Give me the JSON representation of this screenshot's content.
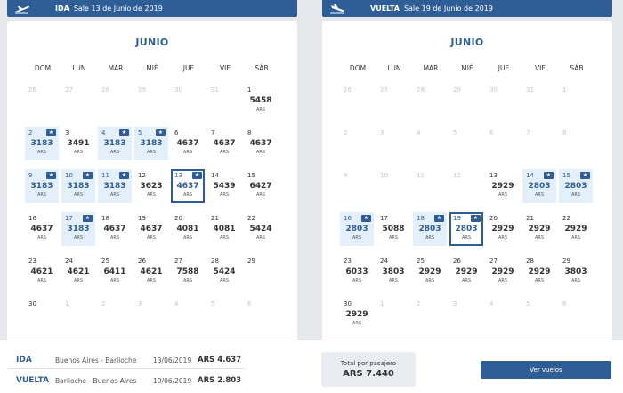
{
  "ida": {
    "label": "IDA",
    "subtitle": "Sale 13 de Junio de 2019",
    "month": "JUNIO",
    "currency": "ARS",
    "days": [
      {
        "n": "26",
        "out": true
      },
      {
        "n": "27",
        "out": true
      },
      {
        "n": "28",
        "out": true
      },
      {
        "n": "29",
        "out": true
      },
      {
        "n": "30",
        "out": true
      },
      {
        "n": "31",
        "out": true
      },
      {
        "n": "1",
        "price": "5458"
      },
      {
        "n": "2",
        "price": "3183",
        "promo": true
      },
      {
        "n": "3",
        "price": "3491"
      },
      {
        "n": "4",
        "price": "3183",
        "promo": true
      },
      {
        "n": "5",
        "price": "3183",
        "promo": true
      },
      {
        "n": "6",
        "price": "4637"
      },
      {
        "n": "7",
        "price": "4637"
      },
      {
        "n": "8",
        "price": "4637"
      },
      {
        "n": "9",
        "price": "3183",
        "promo": true
      },
      {
        "n": "10",
        "price": "3183",
        "promo": true
      },
      {
        "n": "11",
        "price": "3183",
        "promo": true
      },
      {
        "n": "12",
        "price": "3623"
      },
      {
        "n": "13",
        "price": "4637",
        "selected": true
      },
      {
        "n": "14",
        "price": "5439"
      },
      {
        "n": "15",
        "price": "6427"
      },
      {
        "n": "16",
        "price": "4637"
      },
      {
        "n": "17",
        "price": "3183",
        "promo": true
      },
      {
        "n": "18",
        "price": "4637"
      },
      {
        "n": "19",
        "price": "4637"
      },
      {
        "n": "20",
        "price": "4081"
      },
      {
        "n": "21",
        "price": "4081"
      },
      {
        "n": "22",
        "price": "5424"
      },
      {
        "n": "23",
        "price": "4621"
      },
      {
        "n": "24",
        "price": "4621"
      },
      {
        "n": "25",
        "price": "6411"
      },
      {
        "n": "26",
        "price": "4621"
      },
      {
        "n": "27",
        "price": "7588"
      },
      {
        "n": "28",
        "price": "5424"
      },
      {
        "n": "29"
      },
      {
        "n": "30"
      },
      {
        "n": "1",
        "out": true
      },
      {
        "n": "2",
        "out": true
      },
      {
        "n": "3",
        "out": true
      },
      {
        "n": "4",
        "out": true
      },
      {
        "n": "5",
        "out": true
      },
      {
        "n": "6",
        "out": true
      }
    ]
  },
  "vuelta": {
    "label": "VUELTA",
    "subtitle": "Sale 19 de Junio de 2019",
    "month": "JUNIO",
    "currency": "ARS",
    "days": [
      {
        "n": "26",
        "out": true
      },
      {
        "n": "27",
        "out": true
      },
      {
        "n": "28",
        "out": true
      },
      {
        "n": "29",
        "out": true
      },
      {
        "n": "30",
        "out": true
      },
      {
        "n": "31",
        "out": true
      },
      {
        "n": "1",
        "out": true
      },
      {
        "n": "2",
        "out": true
      },
      {
        "n": "3",
        "out": true
      },
      {
        "n": "4",
        "out": true
      },
      {
        "n": "5",
        "out": true
      },
      {
        "n": "6",
        "out": true
      },
      {
        "n": "7",
        "out": true
      },
      {
        "n": "8",
        "out": true
      },
      {
        "n": "9",
        "out": true
      },
      {
        "n": "10",
        "out": true
      },
      {
        "n": "11",
        "out": true
      },
      {
        "n": "12",
        "out": true
      },
      {
        "n": "13",
        "price": "2929"
      },
      {
        "n": "14",
        "price": "2803",
        "promo": true
      },
      {
        "n": "15",
        "price": "2803",
        "promo": true
      },
      {
        "n": "16",
        "price": "2803",
        "promo": true
      },
      {
        "n": "17",
        "price": "5088"
      },
      {
        "n": "18",
        "price": "2803",
        "promo": true
      },
      {
        "n": "19",
        "price": "2803",
        "selected": true
      },
      {
        "n": "20",
        "price": "2929"
      },
      {
        "n": "21",
        "price": "2929"
      },
      {
        "n": "22",
        "price": "2929"
      },
      {
        "n": "23",
        "price": "6033"
      },
      {
        "n": "24",
        "price": "3803"
      },
      {
        "n": "25",
        "price": "2929"
      },
      {
        "n": "26",
        "price": "2929"
      },
      {
        "n": "27",
        "price": "2929"
      },
      {
        "n": "28",
        "price": "2929"
      },
      {
        "n": "29",
        "price": "3803"
      },
      {
        "n": "30",
        "price": "2929"
      },
      {
        "n": "1",
        "out": true
      },
      {
        "n": "2",
        "out": true
      },
      {
        "n": "3",
        "out": true
      },
      {
        "n": "4",
        "out": true
      },
      {
        "n": "5",
        "out": true
      },
      {
        "n": "6",
        "out": true
      }
    ]
  },
  "weekdays": [
    "DOM",
    "LUN",
    "MAR",
    "MIÉ",
    "JUE",
    "VIE",
    "SÁB"
  ],
  "summary": {
    "ida": {
      "label": "IDA",
      "route": "Buenos Aires - Bariloche",
      "date": "13/06/2019",
      "price": "ARS 4.637"
    },
    "vuelta": {
      "label": "VUELTA",
      "route": "Bariloche - Buenos Aires",
      "date": "19/06/2019",
      "price": "ARS 2.803"
    },
    "total_label": "Total por pasajero",
    "total_value": "ARS 7.440",
    "button_label": "Ver vuelos"
  },
  "colors": {
    "accent": "#2f5e96",
    "promo_bg": "#e3effa",
    "background": "#e6e8ec"
  },
  "icons": {
    "promo": "ticket-icon",
    "ida": "plane-takeoff-icon",
    "vuelta": "plane-landing-icon"
  }
}
